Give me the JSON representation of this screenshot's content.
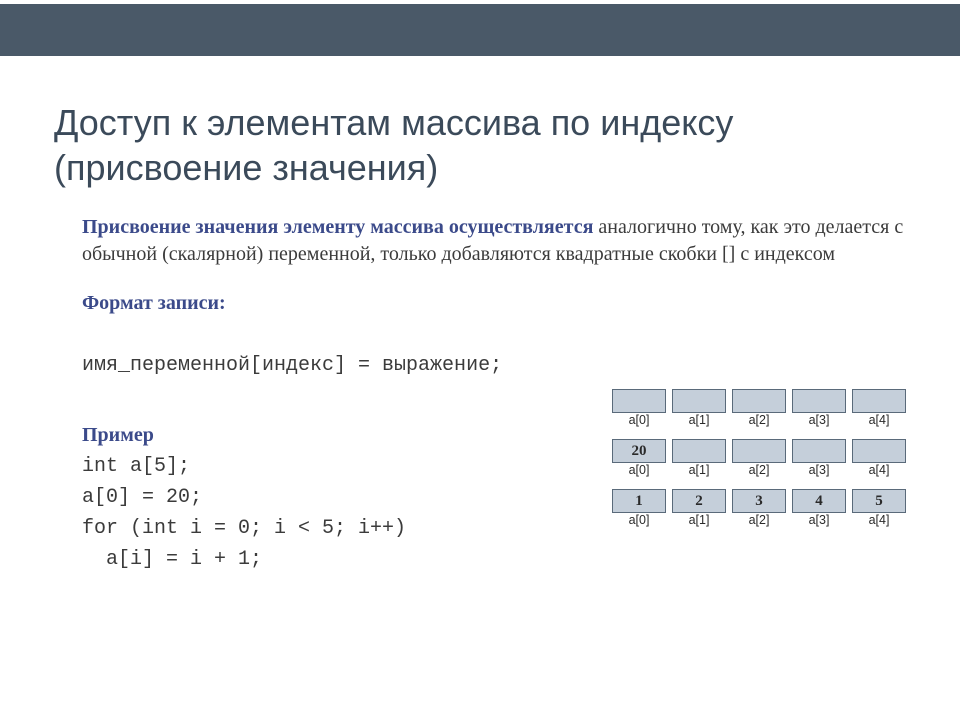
{
  "title": "Доступ к элементам массива по индексу (присвоение значения)",
  "para1_lead": "Присвоение значения элементу массива осуществляется",
  "para1_rest": " аналогично тому, как это делается с обычной (скалярной) переменной, только добавляются квадратные скобки [] с индексом",
  "format_label": "Формат записи:",
  "format_code": "имя_переменной[индекс] = выражение;",
  "example_label": "Пример",
  "code": {
    "l1": "int a[5];",
    "l2": "a[0] = 20;",
    "l3": "for (int i = 0; i < 5; i++)",
    "l4": "  a[i] = i + 1;"
  },
  "labels": [
    "a[0]",
    "a[1]",
    "a[2]",
    "a[3]",
    "a[4]"
  ],
  "tables": {
    "row1": [
      "",
      "",
      "",
      "",
      ""
    ],
    "row2": [
      "20",
      "",
      "",
      "",
      ""
    ],
    "row3": [
      "1",
      "2",
      "3",
      "4",
      "5"
    ]
  }
}
